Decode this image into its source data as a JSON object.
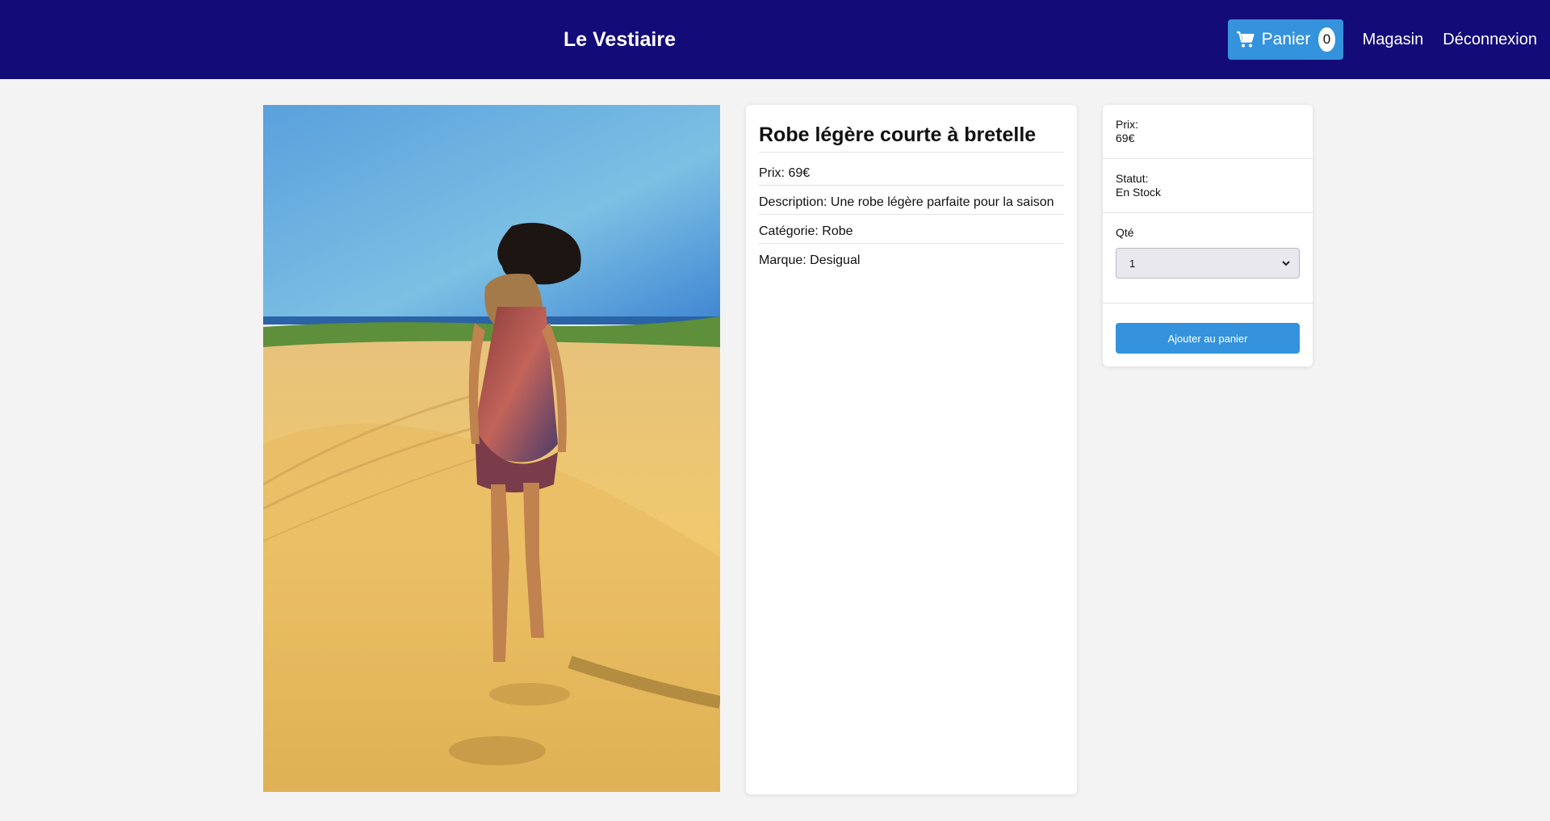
{
  "header": {
    "brand": "Le Vestiaire",
    "cart": {
      "label": "Panier",
      "count": "0",
      "icon": "cart-icon"
    },
    "links": {
      "shop": "Magasin",
      "logout": "Déconnexion"
    }
  },
  "colors": {
    "header_bg": "#130b78",
    "accent": "#3493dc",
    "page_bg": "#f3f3f3"
  },
  "product": {
    "title": "Robe légère courte à bretelle",
    "price_line": "Prix: 69€",
    "description_line": "Description: Une robe légère parfaite pour la saison",
    "category_line": "Catégorie: Robe",
    "brand_line": "Marque: Desigual"
  },
  "purchase": {
    "price_label": "Prix:",
    "price_value": "69€",
    "status_label": "Statut:",
    "status_value": "En Stock",
    "qty_label": "Qté",
    "qty_value": "1",
    "add_button": "Ajouter au panier"
  }
}
